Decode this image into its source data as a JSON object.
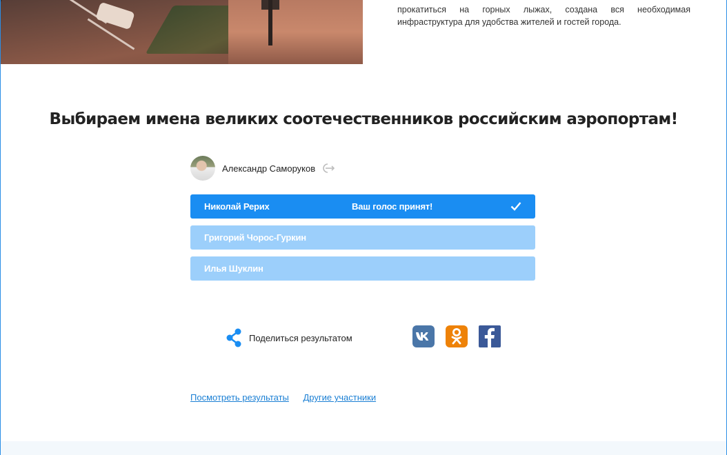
{
  "intro": {
    "text": "прокатиться на горных лыжах, создана вся необходимая инфраструктура для удобства жителей и гостей города."
  },
  "poll": {
    "title": "Выбираем имена великих соотечественников российским аэропортам!",
    "user": {
      "name": "Александр Саморуков"
    },
    "options": [
      {
        "label": "Николай Рерих",
        "status": "Ваш голос принят!",
        "selected": true
      },
      {
        "label": "Григорий Чорос-Гуркин",
        "selected": false
      },
      {
        "label": "Илья Шуклин",
        "selected": false
      }
    ],
    "share": {
      "label": "Поделиться результатом",
      "networks": [
        "vk-icon",
        "odnoklassniki-icon",
        "facebook-icon"
      ]
    },
    "links": {
      "results": "Посмотреть результаты",
      "participants": "Другие участники"
    }
  },
  "colors": {
    "accent": "#1a8df2",
    "option_inactive": "#9ccffb",
    "link": "#1a7fd4",
    "vk": "#4a76a8",
    "ok": "#ee8208",
    "fb": "#3b5998"
  }
}
